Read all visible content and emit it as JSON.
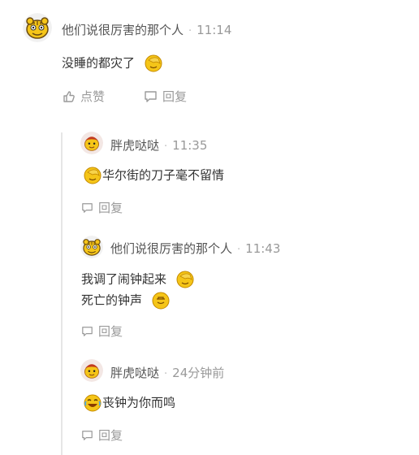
{
  "main_comment": {
    "username": "他们说很厉害的那个人",
    "time": "11:14",
    "text": "没睡的都灾了",
    "actions": {
      "like": "点赞",
      "reply": "回复"
    }
  },
  "replies": [
    {
      "username": "胖虎哒哒",
      "time": "11:35",
      "text": "华尔街的刀子毫不留情",
      "reply": "回复"
    },
    {
      "username": "他们说很厉害的那个人",
      "time": "11:43",
      "line1": "我调了闹钟起来",
      "line2": "死亡的钟声",
      "reply": "回复"
    },
    {
      "username": "胖虎哒哒",
      "time": "24分钟前",
      "text": "丧钟为你而鸣",
      "reply": "回复"
    }
  ],
  "separator": "·",
  "colors": {
    "text": "#333333",
    "muted": "#999999",
    "line": "#e6e6e6",
    "emoji": "#f5c518"
  }
}
